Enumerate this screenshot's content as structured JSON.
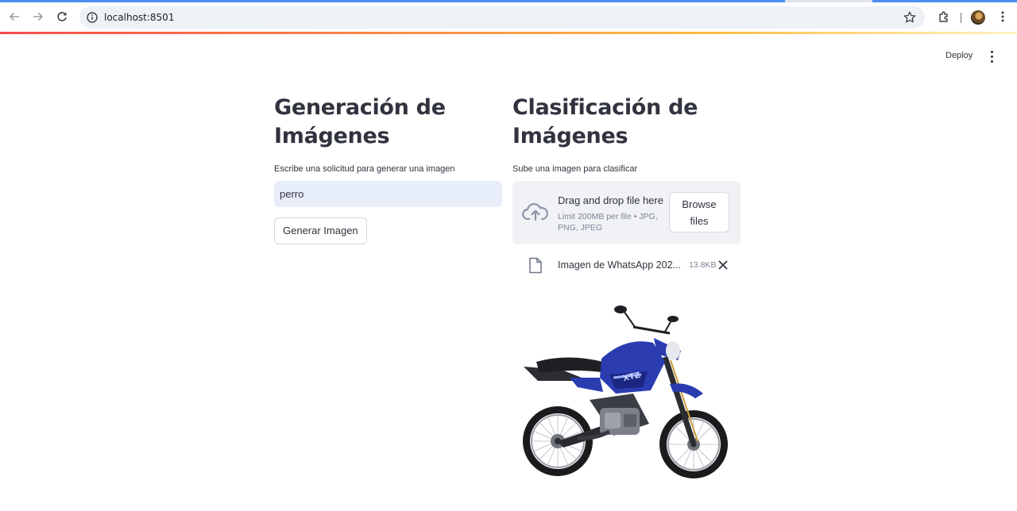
{
  "browser": {
    "url": "localhost:8501"
  },
  "header": {
    "deploy_label": "Deploy"
  },
  "left_column": {
    "title_line1": "Generación de",
    "title_line2": "Imágenes",
    "prompt_label": "Escribe una solicitud para generar una imagen",
    "prompt_value": "perro",
    "generate_button": "Generar Imagen"
  },
  "right_column": {
    "title_line1": "Clasificación de",
    "title_line2": "Imágenes",
    "upload_label": "Sube una imagen para clasificar",
    "dropzone_title": "Drag and drop file here",
    "dropzone_limits": "Limit 200MB per file • JPG, PNG, JPEG",
    "browse_line1": "Browse",
    "browse_line2": "files",
    "uploaded_file": {
      "name": "Imagen de WhatsApp 202...",
      "size": "13.8KB"
    }
  },
  "colors": {
    "accent_tab": "#4d8ff2",
    "input_bg": "#e8eef9",
    "dropzone_bg": "#f0f2f6",
    "bike_blue": "#2a3cb0"
  },
  "icons": [
    "back-icon",
    "forward-icon",
    "reload-icon",
    "info-icon",
    "star-icon",
    "extensions-icon",
    "chrome-menu-icon",
    "kebab-menu-icon",
    "upload-cloud-icon",
    "file-icon",
    "close-icon"
  ]
}
